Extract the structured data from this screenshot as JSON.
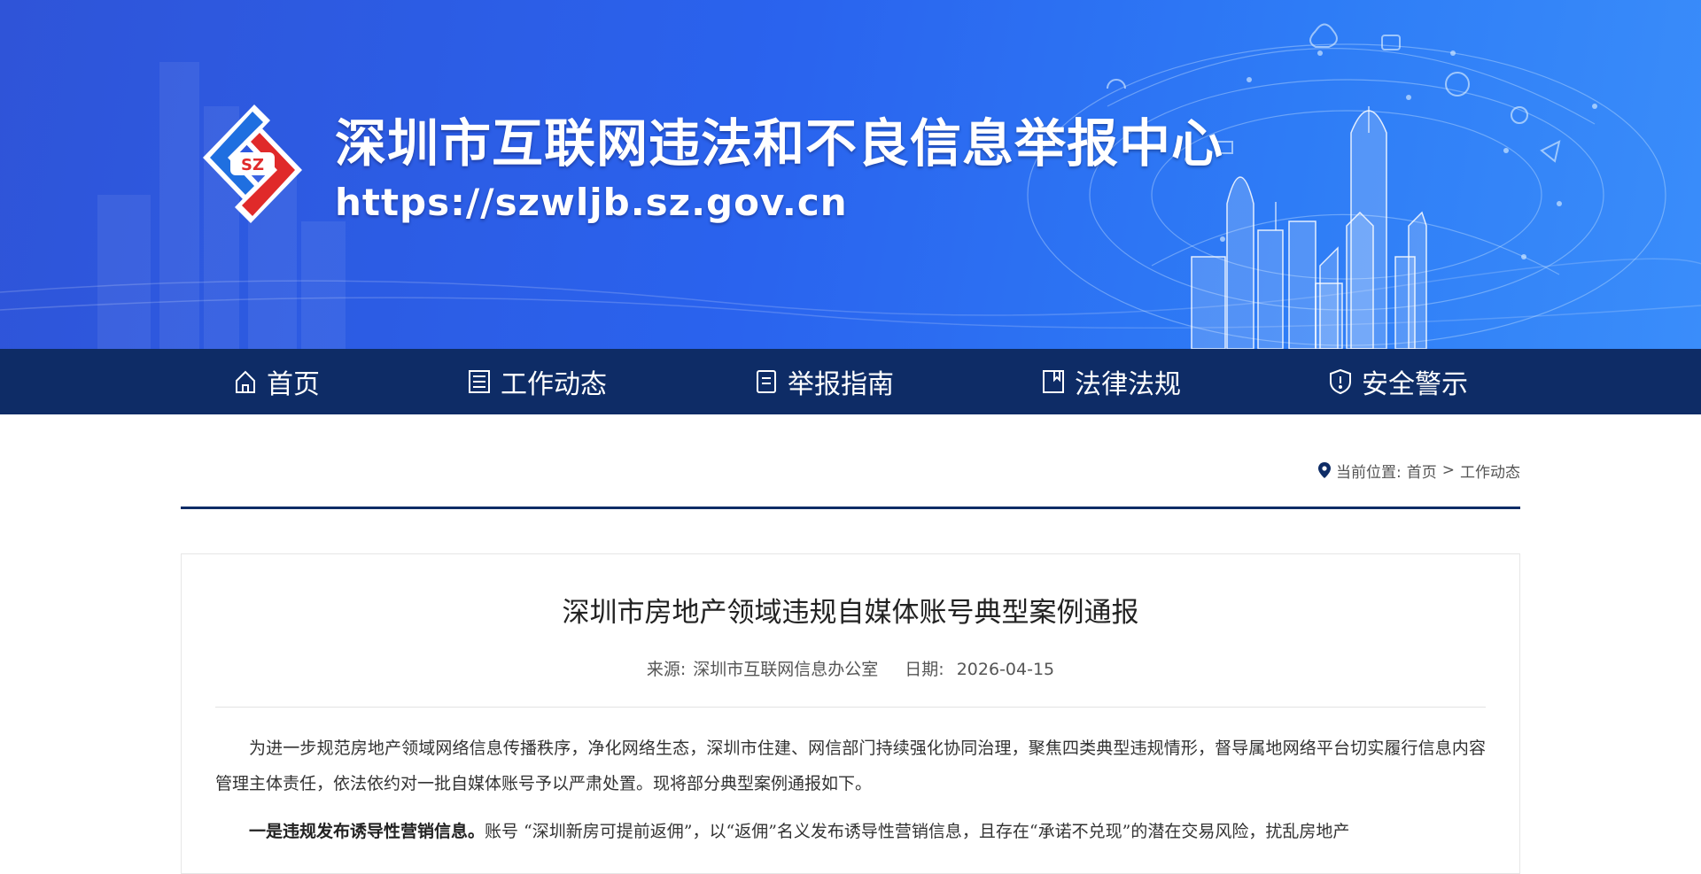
{
  "header": {
    "site_title": "深圳市互联网违法和不良信息举报中心",
    "site_url": "https://szwljb.sz.gov.cn",
    "logo_text": "SZ"
  },
  "nav": {
    "items": [
      {
        "label": "首页",
        "icon": "home-icon"
      },
      {
        "label": "工作动态",
        "icon": "list-icon"
      },
      {
        "label": "举报指南",
        "icon": "document-icon"
      },
      {
        "label": "法律法规",
        "icon": "book-icon"
      },
      {
        "label": "安全警示",
        "icon": "shield-alert-icon"
      }
    ]
  },
  "breadcrumb": {
    "prefix": "当前位置:",
    "home": "首页",
    "separator": ">",
    "current": "工作动态"
  },
  "article": {
    "title": "深圳市房地产领域违规自媒体账号典型案例通报",
    "source_label": "来源:",
    "source": "深圳市互联网信息办公室",
    "date_label": "日期:",
    "date": "2026-04-15",
    "paragraph1": "为进一步规范房地产领域网络信息传播秩序，净化网络生态，深圳市住建、网信部门持续强化协同治理，聚焦四类典型违规情形，督导属地网络平台切实履行信息内容管理主体责任，依法依约对一批自媒体账号予以严肃处置。现将部分典型案例通报如下。",
    "paragraph2_bold": "一是违规发布诱导性营销信息。",
    "paragraph2_text": "账号 “深圳新房可提前返佣”，以“返佣”名义发布诱导性营销信息，且存在“承诺不兑现”的潜在交易风险，扰乱房地产"
  },
  "colors": {
    "nav_bg": "#0e2c66",
    "banner_start": "#2f54d8",
    "banner_end": "#3a8dfa",
    "logo_blue": "#1f6fe0",
    "logo_red": "#e02a2a"
  }
}
